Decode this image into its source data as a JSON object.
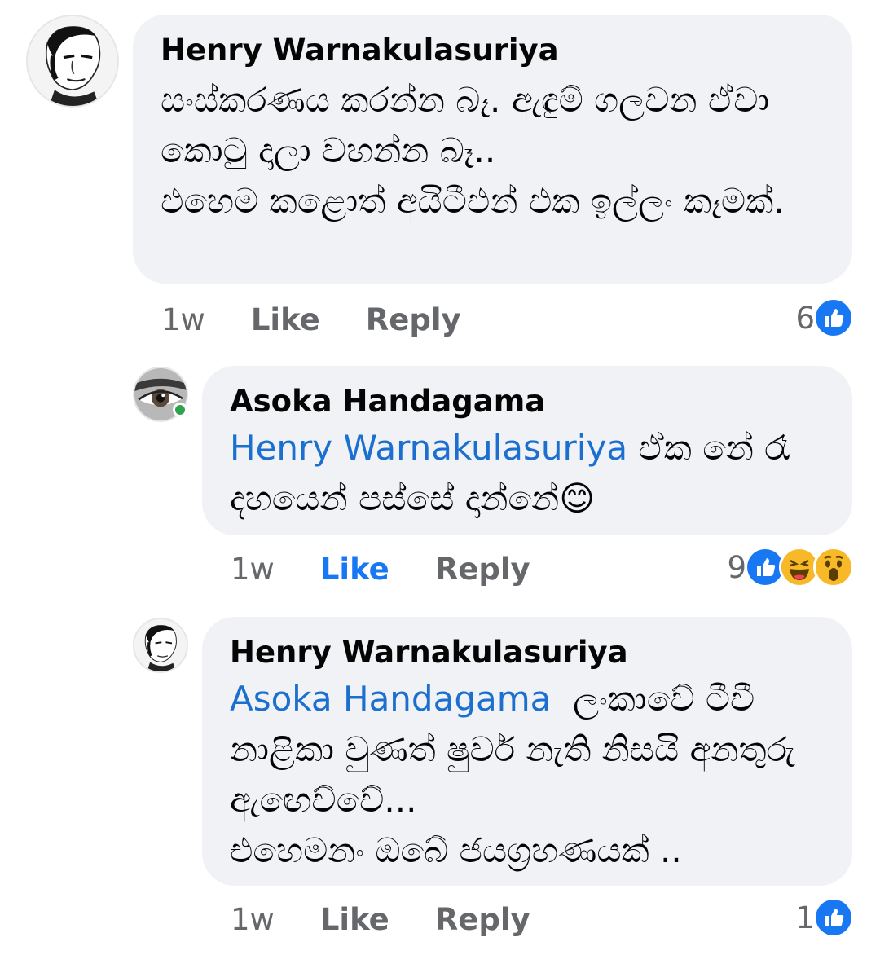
{
  "comments": [
    {
      "author": "Henry Warnakulasuriya",
      "text": "සංස්කරණය කරන්න බෑ. ඇඳුම් ගලවන ඒවා කොටු දාලා වහන්න බෑ..\nඑහෙම කළොත් අයිටීඑන් එක ඉල්ලං කෑමක්.",
      "time": "1w",
      "like_label": "Like",
      "reply_label": "Reply",
      "reaction_count": "6",
      "reactions": [
        "like-reaction-icon"
      ]
    },
    {
      "author": "Asoka Handagama",
      "mention": "Henry Warnakulasuriya",
      "text": " ඒක නේ රෑ දහයෙන් පස්සේ දාන්නේ😊",
      "time": "1w",
      "like_label": "Like",
      "reply_label": "Reply",
      "reaction_count": "9",
      "reactions": [
        "like-reaction-icon",
        "haha-reaction-icon",
        "wow-reaction-icon"
      ]
    },
    {
      "author": "Henry Warnakulasuriya",
      "mention": "Asoka Handagama",
      "text": "  ලංකාවේ ටීවී නාළිකා වුණත් ෂුවර් නැති නිසයි අනතුරු ඇඟෙව්වේ...\nඑහෙමනං ඔබේ ජයග්‍රහණයක් ..",
      "time": "1w",
      "like_label": "Like",
      "reply_label": "Reply",
      "reaction_count": "1",
      "reactions": [
        "like-reaction-icon"
      ]
    }
  ],
  "colors": {
    "bubble": "#f0f2f5",
    "mention": "#1b6fcf",
    "like_active": "#1877f2",
    "meta": "#65676b",
    "online": "#31a24c"
  }
}
